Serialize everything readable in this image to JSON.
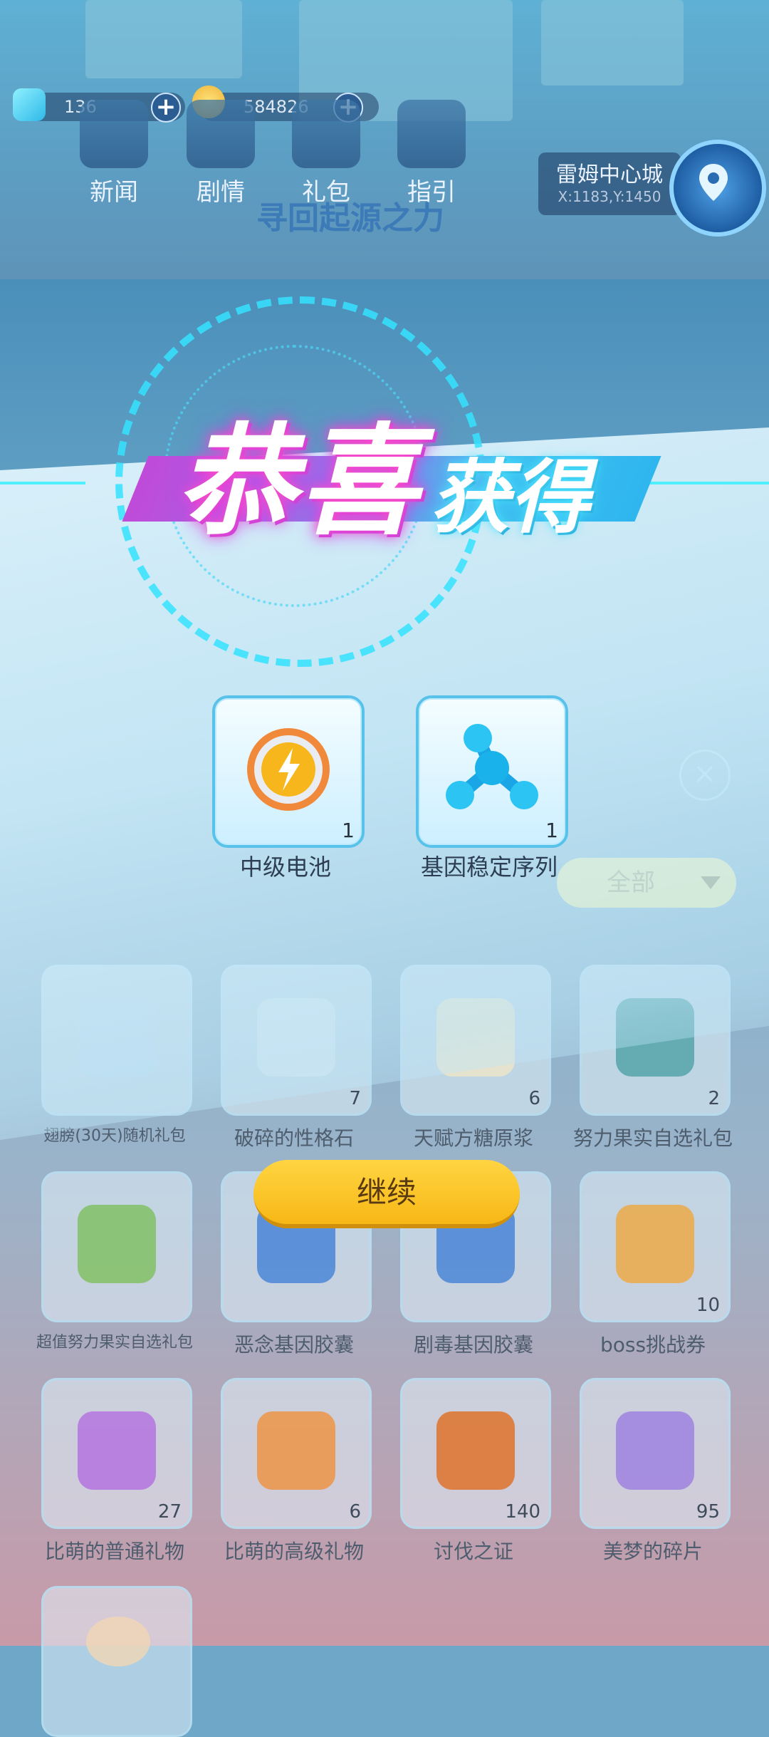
{
  "hud": {
    "diamonds": "136",
    "coins": "584826",
    "nav": [
      "新闻",
      "剧情",
      "礼包",
      "指引"
    ],
    "banner": "寻回起源之力",
    "city_name": "雷姆中心城",
    "city_coord": "X:1183,Y:1450"
  },
  "reward": {
    "title_main": "恭喜",
    "title_sub": "获得",
    "items": [
      {
        "name": "中级电池",
        "count": "1",
        "icon": "battery-icon"
      },
      {
        "name": "基因稳定序列",
        "count": "1",
        "icon": "molecule-icon"
      }
    ],
    "continue_label": "继续"
  },
  "inventory": {
    "filter_label": "全部",
    "rows": [
      [
        {
          "name": "翅膀(30天)随机礼包",
          "count": "",
          "icon": "wing-pack-icon"
        },
        {
          "name": "破碎的性格石",
          "count": "7",
          "icon": "stone-icon"
        },
        {
          "name": "天赋方糖原浆",
          "count": "6",
          "icon": "jar-icon"
        },
        {
          "name": "努力果实自选礼包",
          "count": "2",
          "icon": "gift-box-icon"
        }
      ],
      [
        {
          "name": "超值努力果实自选礼包",
          "count": "",
          "icon": "fruit-crate-icon"
        },
        {
          "name": "恶念基因胶囊",
          "count": "",
          "icon": "capsule-icon"
        },
        {
          "name": "剧毒基因胶囊",
          "count": "",
          "icon": "capsule-icon"
        },
        {
          "name": "boss挑战券",
          "count": "10",
          "icon": "ticket-icon"
        }
      ],
      [
        {
          "name": "比萌的普通礼物",
          "count": "27",
          "icon": "purple-gift-icon"
        },
        {
          "name": "比萌的高级礼物",
          "count": "6",
          "icon": "orange-gift-icon"
        },
        {
          "name": "讨伐之证",
          "count": "140",
          "icon": "dragon-eye-icon"
        },
        {
          "name": "美梦的碎片",
          "count": "95",
          "icon": "dream-shard-icon"
        }
      ]
    ]
  }
}
